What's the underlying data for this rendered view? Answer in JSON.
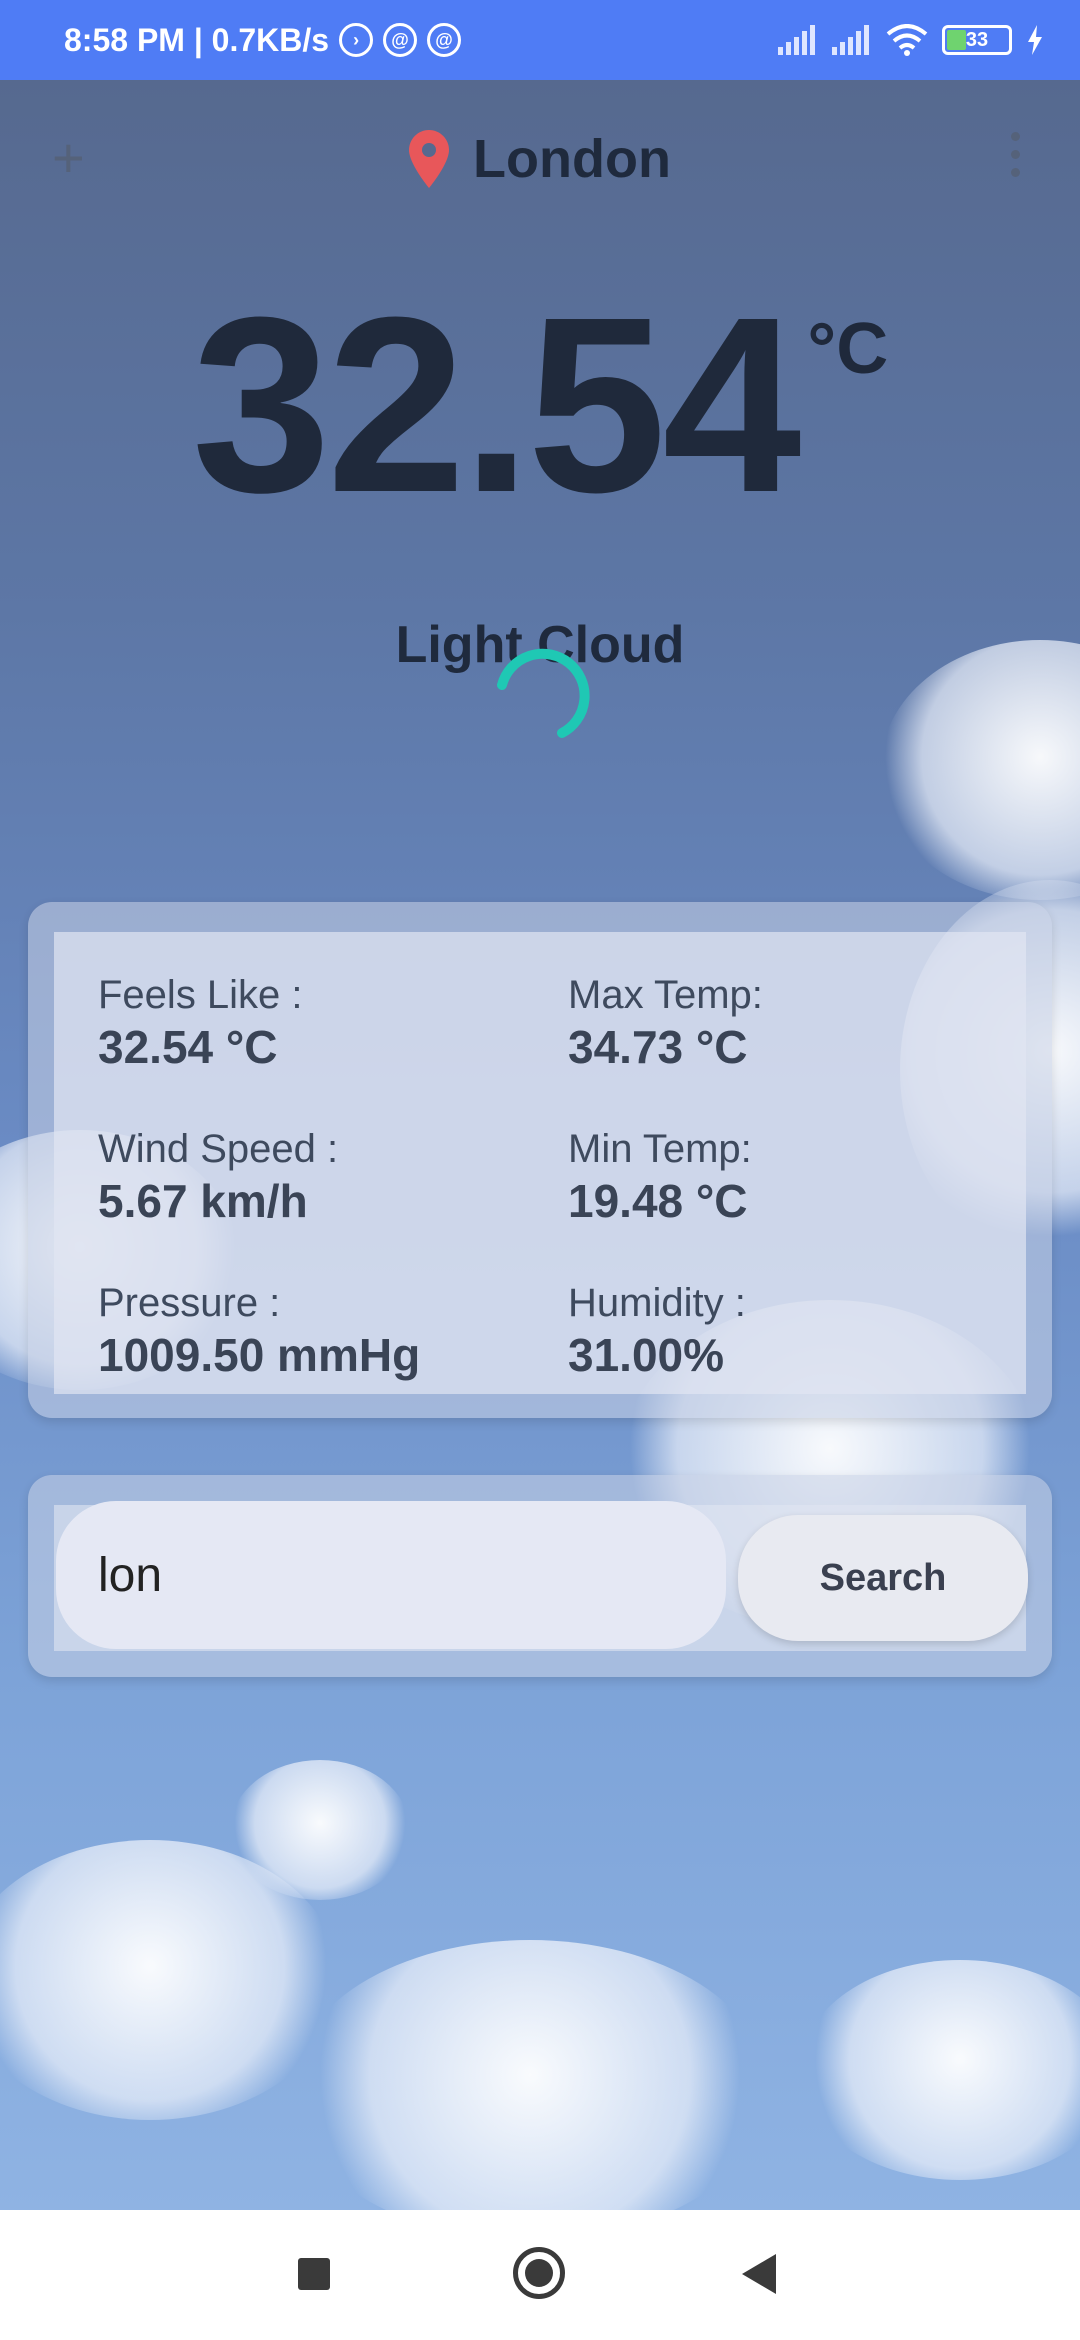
{
  "status_bar": {
    "time_speed": "8:58 PM | 0.7KB/s",
    "battery": "33"
  },
  "header": {
    "city": "London",
    "add_icon": "plus-icon",
    "menu_icon": "more-vert-icon",
    "location_icon": "map-pin-icon"
  },
  "weather": {
    "temperature": "32.54",
    "unit": "°C",
    "condition": "Light Cloud"
  },
  "stats": {
    "feels_like": {
      "label": "Feels Like :",
      "value": "32.54 °C"
    },
    "max_temp": {
      "label": "Max Temp:",
      "value": "34.73 °C"
    },
    "wind_speed": {
      "label": "Wind Speed :",
      "value": "5.67 km/h"
    },
    "min_temp": {
      "label": "Min Temp:",
      "value": "19.48 °C"
    },
    "pressure": {
      "label": "Pressure :",
      "value": "1009.50 mmHg"
    },
    "humidity": {
      "label": "Humidity :",
      "value": "31.00%"
    }
  },
  "search": {
    "value": "lon",
    "button_label": "Search"
  },
  "colors": {
    "status_bar": "#4f7cf5",
    "pin": "#e8575a",
    "spinner": "#1fc8b4"
  }
}
